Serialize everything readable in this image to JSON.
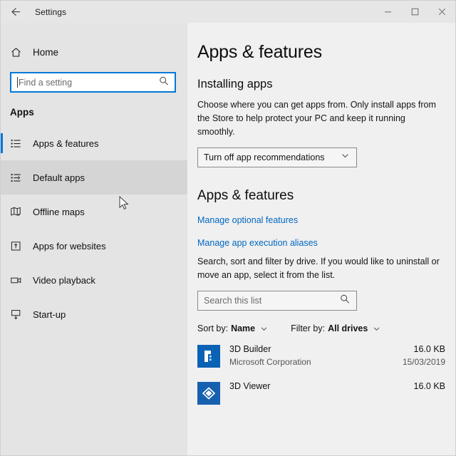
{
  "window": {
    "title": "Settings",
    "back_icon": "back-arrow-icon",
    "controls": {
      "minimize": "minimize-icon",
      "maximize": "maximize-icon",
      "close": "close-icon"
    }
  },
  "sidebar": {
    "home_label": "Home",
    "home_icon": "home-icon",
    "search": {
      "placeholder": "Find a setting",
      "icon": "search-icon",
      "value": ""
    },
    "section_title": "Apps",
    "items": [
      {
        "label": "Apps & features",
        "icon": "list-bullets-icon",
        "selected": true,
        "hovered": false
      },
      {
        "label": "Default apps",
        "icon": "list-arrow-icon",
        "selected": false,
        "hovered": true
      },
      {
        "label": "Offline maps",
        "icon": "map-icon",
        "selected": false,
        "hovered": false
      },
      {
        "label": "Apps for websites",
        "icon": "box-arrow-icon",
        "selected": false,
        "hovered": false
      },
      {
        "label": "Video playback",
        "icon": "video-camera-icon",
        "selected": false,
        "hovered": false
      },
      {
        "label": "Start-up",
        "icon": "monitor-arrow-icon",
        "selected": false,
        "hovered": false
      }
    ]
  },
  "main": {
    "page_title": "Apps & features",
    "installing": {
      "heading": "Installing apps",
      "description": "Choose where you can get apps from. Only install apps from the Store to help protect your PC and keep it running smoothly.",
      "dropdown_value": "Turn off app recommendations",
      "dropdown_icon": "chevron-down-icon"
    },
    "features": {
      "heading": "Apps & features",
      "link_optional_features": "Manage optional features",
      "link_execution_aliases": "Manage app execution aliases",
      "description": "Search, sort and filter by drive. If you would like to uninstall or move an app, select it from the list.",
      "search_placeholder": "Search this list",
      "search_icon": "search-icon",
      "search_value": ""
    },
    "filters": {
      "sort_label": "Sort by:",
      "sort_value": "Name",
      "filter_label": "Filter by:",
      "filter_value": "All drives",
      "chevron_icon": "chevron-down-icon"
    },
    "apps": [
      {
        "name": "3D Builder",
        "publisher": "Microsoft Corporation",
        "size": "16.0 KB",
        "date": "15/03/2019",
        "icon": "3d-builder-icon"
      },
      {
        "name": "3D Viewer",
        "publisher": "",
        "size": "16.0 KB",
        "date": "",
        "icon": "3d-viewer-icon"
      }
    ]
  },
  "colors": {
    "accent": "#0078d7",
    "link": "#0067c0",
    "sidebar_bg": "#e4e4e4",
    "content_bg": "#f0f0f0",
    "titlebar_bg": "#e6e6e6"
  },
  "cursor": {
    "icon": "mouse-pointer-icon"
  }
}
